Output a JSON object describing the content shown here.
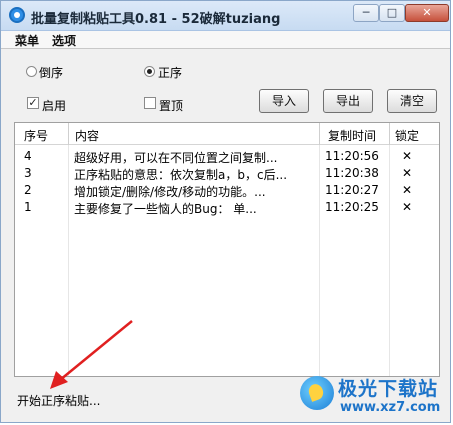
{
  "window": {
    "title": "批量复制粘贴工具0.81 - 52破解tuziang",
    "controls": {
      "minimize": "─",
      "maximize": "□",
      "close": "✕"
    }
  },
  "menu": {
    "items": [
      "菜单",
      "选项"
    ]
  },
  "options": {
    "order_reverse": {
      "label": "倒序",
      "checked": false
    },
    "order_forward": {
      "label": "正序",
      "checked": true
    },
    "enable": {
      "label": "启用",
      "checked": true
    },
    "pin_top": {
      "label": "置顶",
      "checked": false
    }
  },
  "buttons": {
    "import": "导入",
    "export": "导出",
    "clear": "清空"
  },
  "table": {
    "columns": [
      "序号",
      "内容",
      "复制时间",
      "锁定"
    ],
    "rows": [
      {
        "index": "4",
        "content": "超级好用，可以在不同位置之间复制...",
        "time": "11:20:56",
        "lock": "✕"
      },
      {
        "index": "3",
        "content": "  正序粘贴的意思：依次复制a，b，c后...",
        "time": "11:20:38",
        "lock": "✕"
      },
      {
        "index": "2",
        "content": "    增加锁定/删除/修改/移动的功能。...",
        "time": "11:20:27",
        "lock": "✕"
      },
      {
        "index": "1",
        "content": "     主要修复了一些恼人的Bug：     单...",
        "time": "11:20:25",
        "lock": "✕"
      }
    ]
  },
  "status": {
    "text": "开始正序粘贴..."
  },
  "watermark": {
    "title": "极光下载站",
    "url": "www.xz7.com"
  },
  "colors": {
    "accent": "#1d74c9",
    "arrow": "#e02020"
  }
}
